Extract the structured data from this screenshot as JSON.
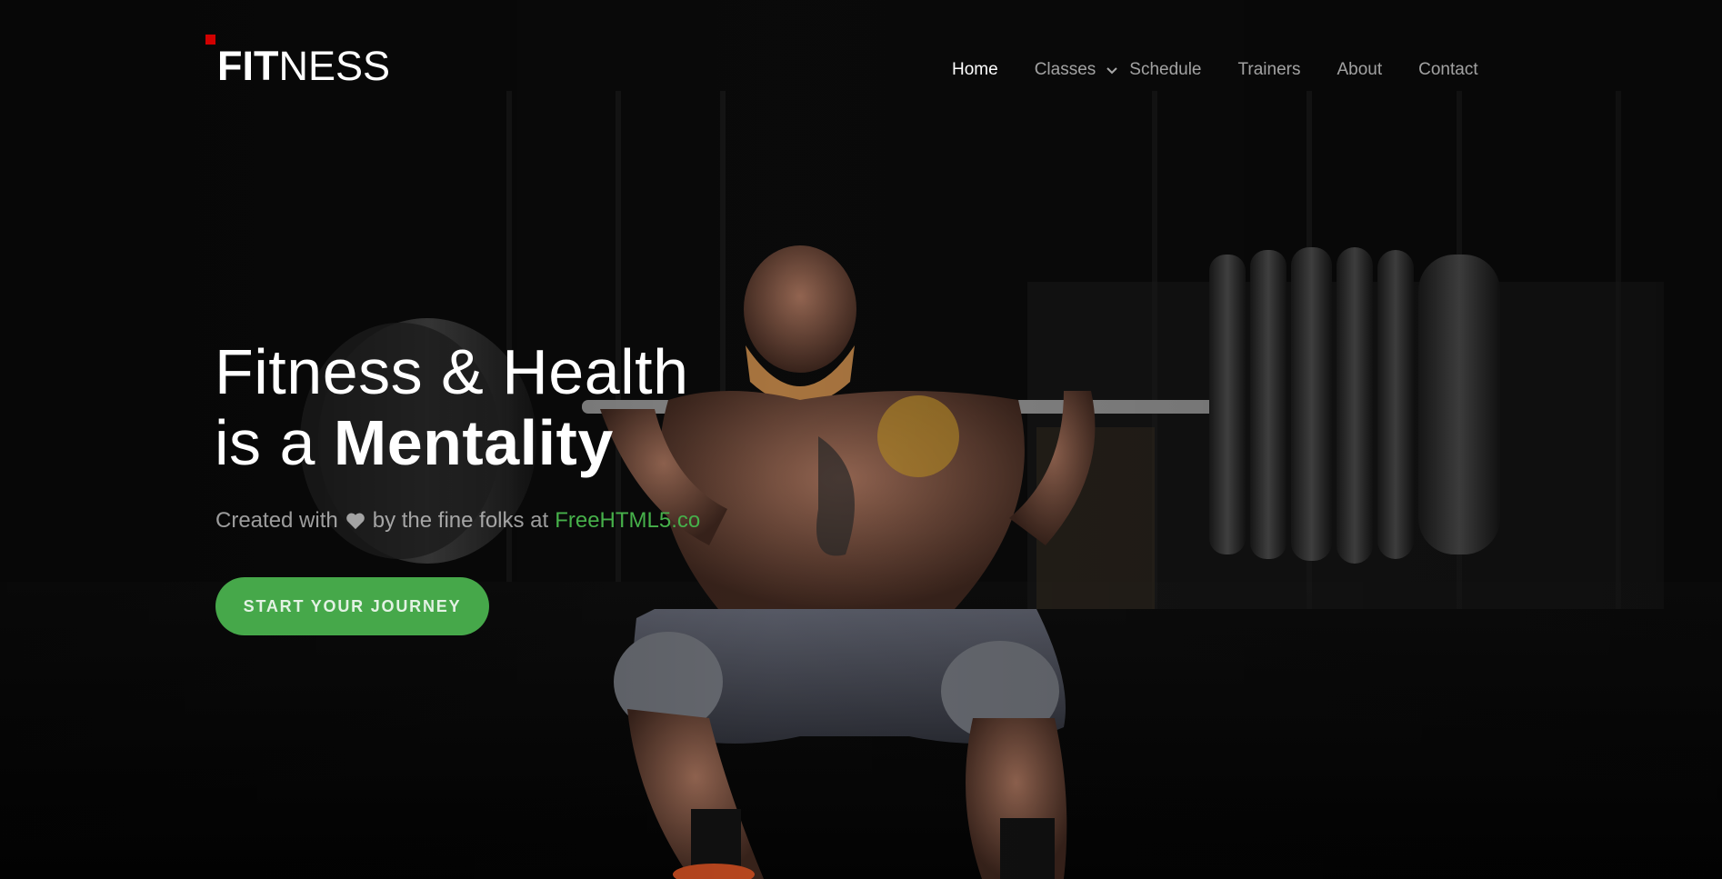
{
  "brand": {
    "logo_bold": "FIT",
    "logo_light": "NESS",
    "accent_color": "#d10000"
  },
  "nav": {
    "items": [
      {
        "label": "Home",
        "active": true
      },
      {
        "label": "Classes",
        "has_dropdown": true
      },
      {
        "label": "Schedule"
      },
      {
        "label": "Trainers"
      },
      {
        "label": "About"
      },
      {
        "label": "Contact"
      }
    ]
  },
  "hero": {
    "headline_line1": "Fitness & Health",
    "headline_line2_prefix": "is a ",
    "headline_line2_strong": "Mentality",
    "credit_prefix": "Created with",
    "credit_icon": "heart-icon",
    "credit_middle": "by the fine folks at",
    "credit_link": "FreeHTML5.co",
    "credit_link_color": "#46b04a",
    "cta_label": "START YOUR JOURNEY",
    "cta_color": "#46a84a"
  }
}
